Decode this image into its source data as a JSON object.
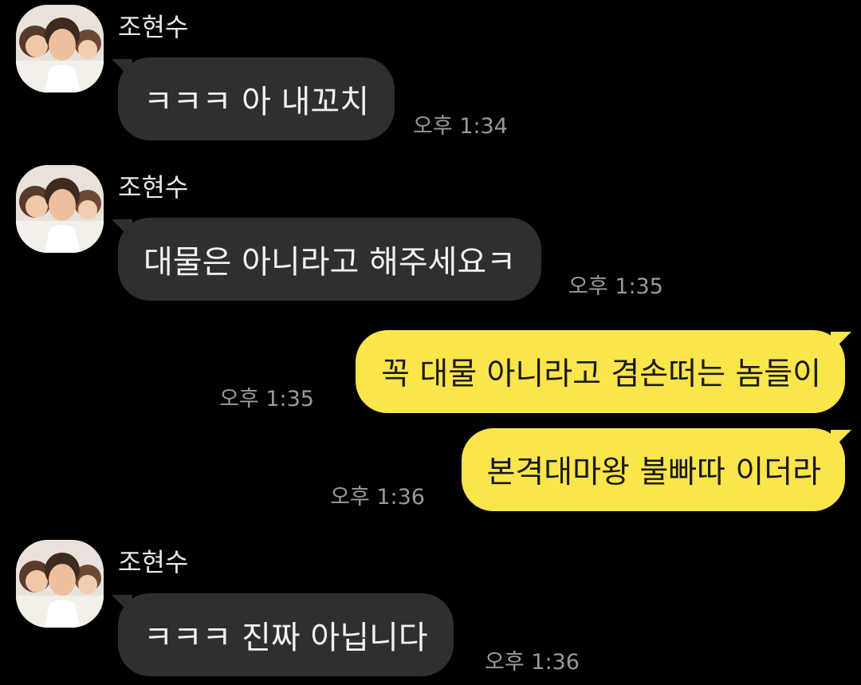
{
  "messages": [
    {
      "direction": "incoming",
      "sender": "조현수",
      "text": "ㅋㅋㅋ 아 내꼬치",
      "time": "오후 1:34",
      "avatar": "profile-photo"
    },
    {
      "direction": "incoming",
      "sender": "조현수",
      "text": "대물은 아니라고 해주세요ㅋ",
      "time": "오후 1:35",
      "avatar": "profile-photo"
    },
    {
      "direction": "outgoing",
      "text": "꼭 대물 아니라고 겸손떠는 놈들이",
      "time": "오후 1:35"
    },
    {
      "direction": "outgoing",
      "text": "본격대마왕 불빠따 이더라",
      "time": "오후 1:36"
    },
    {
      "direction": "incoming",
      "sender": "조현수",
      "text": "ㅋㅋㅋ 진짜 아닙니다",
      "time": "오후 1:36",
      "avatar": "profile-photo"
    }
  ],
  "colors": {
    "background": "#000000",
    "incoming_bubble": "#2f2f2f",
    "outgoing_bubble": "#fae54b",
    "time_text": "#9a9a9a"
  }
}
